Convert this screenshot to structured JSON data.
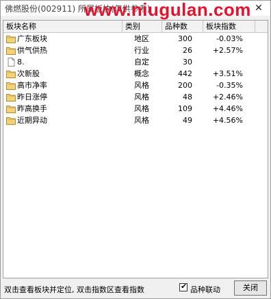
{
  "window": {
    "title": "佛燃股份(002911) 所属板块(仅供参考)",
    "watermark": "www.niugulan.com"
  },
  "columns": [
    "板块名称",
    "类别",
    "品种数",
    "板块指数"
  ],
  "rows": [
    {
      "name": "广东板块",
      "category": "地区",
      "count": "300",
      "change": "-0.03%",
      "icon": "folder-icon"
    },
    {
      "name": "供气供热",
      "category": "行业",
      "count": "26",
      "change": "+2.57%",
      "icon": "folder-icon"
    },
    {
      "name": "8.",
      "category": "自定",
      "count": "30",
      "change": "",
      "icon": "document-icon"
    },
    {
      "name": "次新股",
      "category": "概念",
      "count": "442",
      "change": "+3.51%",
      "icon": "folder-icon"
    },
    {
      "name": "高市净率",
      "category": "风格",
      "count": "200",
      "change": "-0.35%",
      "icon": "folder-icon"
    },
    {
      "name": "昨日涨停",
      "category": "风格",
      "count": "48",
      "change": "+2.46%",
      "icon": "folder-icon"
    },
    {
      "name": "昨高换手",
      "category": "风格",
      "count": "109",
      "change": "+4.46%",
      "icon": "folder-icon"
    },
    {
      "name": "近期异动",
      "category": "风格",
      "count": "49",
      "change": "+4.56%",
      "icon": "folder-icon"
    }
  ],
  "footer": {
    "hint": "双击查看板块并定位, 双击指数区查看指数",
    "checkbox_label": "品种联动",
    "checkbox_checked": true,
    "close_button": "关闭"
  }
}
